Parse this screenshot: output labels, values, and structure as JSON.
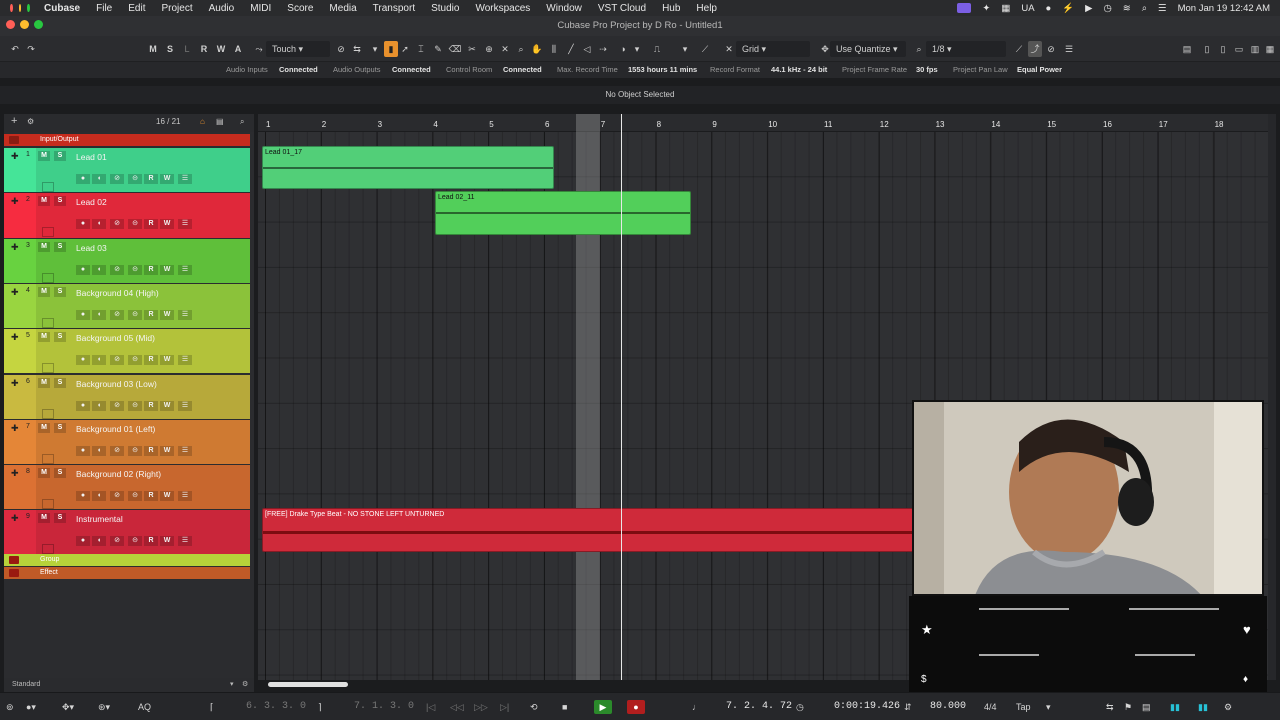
{
  "menubar": {
    "app": "Cubase",
    "items": [
      "File",
      "Edit",
      "Project",
      "Audio",
      "MIDI",
      "Score",
      "Media",
      "Transport",
      "Studio",
      "Workspaces",
      "Window",
      "VST Cloud",
      "Hub",
      "Help"
    ],
    "input_lang": "UA",
    "datetime": "Mon Jan 19  12:42 AM"
  },
  "window": {
    "title": "Cubase Pro Project by D Ro - Untitled1"
  },
  "toolbar": {
    "mode_buttons": [
      "M",
      "S",
      "L",
      "R",
      "W",
      "A"
    ],
    "automation_mode": "Touch",
    "snap_type": "Grid",
    "quantize_mode": "Use Quantize",
    "quantize_value": "1/8"
  },
  "status": {
    "audio_inputs_label": "Audio Inputs",
    "audio_inputs_value": "Connected",
    "audio_outputs_label": "Audio Outputs",
    "audio_outputs_value": "Connected",
    "control_room_label": "Control Room",
    "control_room_value": "Connected",
    "max_record_label": "Max. Record Time",
    "max_record_value": "1553 hours 11 mins",
    "record_format_label": "Record Format",
    "record_format_value": "44.1 kHz - 24 bit",
    "frame_rate_label": "Project Frame Rate",
    "frame_rate_value": "30 fps",
    "pan_law_label": "Project Pan Law",
    "pan_law_value": "Equal Power"
  },
  "info_line": "No Object Selected",
  "track_header": {
    "count": "16 / 21"
  },
  "folders": {
    "input_output": "Input/Output",
    "group": "Group",
    "effect": "Effect"
  },
  "tracks": [
    {
      "num": "1",
      "name": "Lead 01",
      "color": "#3fcf8a"
    },
    {
      "num": "2",
      "name": "Lead 02",
      "color": "#e0283a"
    },
    {
      "num": "3",
      "name": "Lead 03",
      "color": "#5fbf3a"
    },
    {
      "num": "4",
      "name": "Background 04 (High)",
      "color": "#8bc23a"
    },
    {
      "num": "5",
      "name": "Background 05 (Mid)",
      "color": "#b3c23a"
    },
    {
      "num": "6",
      "name": "Background 03 (Low)",
      "color": "#b7a93a"
    },
    {
      "num": "7",
      "name": "Background 01 (Left)",
      "color": "#cf7a32"
    },
    {
      "num": "8",
      "name": "Background 02 (Right)",
      "color": "#c8672e"
    },
    {
      "num": "9",
      "name": "Instrumental",
      "color": "#c9263a"
    }
  ],
  "track_buttons": {
    "mute": "M",
    "solo": "S",
    "read": "R",
    "write": "W"
  },
  "ruler": [
    "1",
    "2",
    "3",
    "4",
    "5",
    "6",
    "7",
    "8",
    "9",
    "10",
    "11",
    "12",
    "13",
    "14",
    "15",
    "16",
    "17",
    "18"
  ],
  "events": [
    {
      "name": "Lead 01_17"
    },
    {
      "name": "Lead 02_11"
    },
    {
      "name": "[FREE] Drake Type Beat - NO STONE LEFT UNTURNED"
    }
  ],
  "bottom": {
    "window_layout": "Standard"
  },
  "transport": {
    "left_locator": "6. 3. 3.   0",
    "right_locator": "7. 1. 3.   0",
    "position_bars": "7. 2. 4.  72",
    "position_time": "0:00:19.426",
    "tempo": "80.000",
    "signature": "4/4",
    "tap": "Tap",
    "aq": "AQ"
  }
}
